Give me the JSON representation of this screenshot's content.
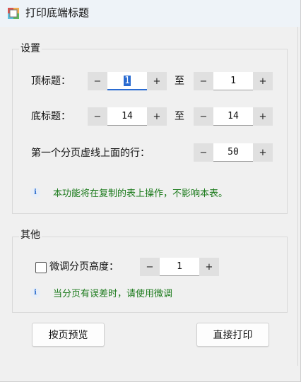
{
  "window": {
    "title": "打印底端标题"
  },
  "settings_group": {
    "label": "设置",
    "top_title": {
      "label": "顶标题：",
      "from": "1",
      "to_label": "至",
      "to": "1"
    },
    "bottom_title": {
      "label": "底标题：",
      "from": "14",
      "to_label": "至",
      "to": "14"
    },
    "first_page_row": {
      "label": "第一个分页虚线上面的行：",
      "value": "50"
    },
    "info": "本功能将在复制的表上操作，不影响本表。"
  },
  "other_group": {
    "label": "其他",
    "fine_tune": {
      "label": "微调分页高度：",
      "checked": false,
      "value": "1"
    },
    "info": "当分页有误差时，请使用微调"
  },
  "buttons": {
    "preview": "按页预览",
    "print": "直接打印"
  },
  "stepper": {
    "minus": "−",
    "plus": "+"
  },
  "icons": {
    "info": "i"
  },
  "colors": {
    "info_text": "#1b7a1b",
    "accent": "#2a6bd1"
  }
}
